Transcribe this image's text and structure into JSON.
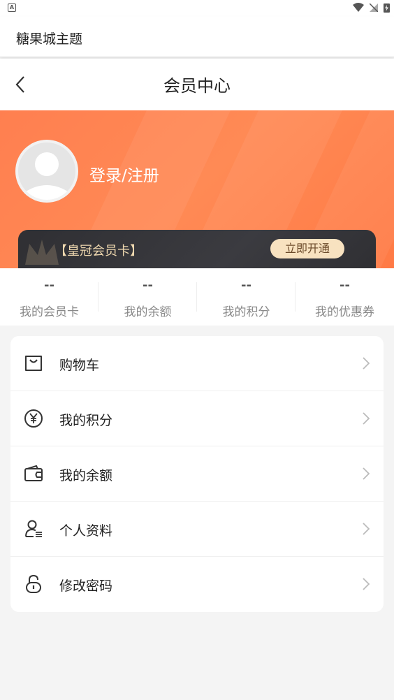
{
  "app": {
    "title": "糖果城主题"
  },
  "nav": {
    "title": "会员中心"
  },
  "profile": {
    "login_label": "登录/注册"
  },
  "vip": {
    "name": "【皇冠会员卡】",
    "button_label": "立即开通"
  },
  "stats": [
    {
      "value": "--",
      "label": "我的会员卡"
    },
    {
      "value": "--",
      "label": "我的余额"
    },
    {
      "value": "--",
      "label": "我的积分"
    },
    {
      "value": "--",
      "label": "我的优惠券"
    }
  ],
  "menu": [
    {
      "label": "购物车",
      "icon": "shopping-bag-icon"
    },
    {
      "label": "我的积分",
      "icon": "yen-coin-icon"
    },
    {
      "label": "我的余额",
      "icon": "wallet-icon"
    },
    {
      "label": "个人资料",
      "icon": "user-profile-icon"
    },
    {
      "label": "修改密码",
      "icon": "lock-icon"
    }
  ],
  "colors": {
    "accent": "#ff7f50",
    "vip_card": "#333338",
    "vip_gold": "#f0d9b0"
  }
}
